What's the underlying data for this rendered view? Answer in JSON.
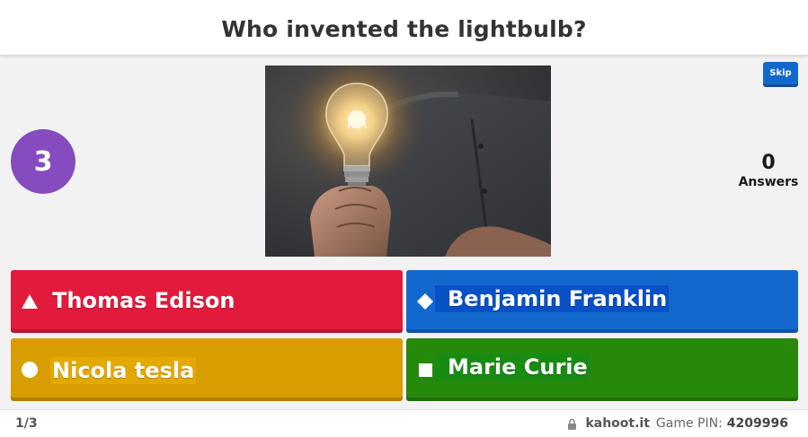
{
  "question": {
    "title": "Who invented the lightbulb?"
  },
  "timer": {
    "value": "3"
  },
  "skip": {
    "label": "Skip"
  },
  "answers_counter": {
    "count": "0",
    "label": "Answers"
  },
  "image": {
    "description_icon": "lightbulb-in-hand-photo"
  },
  "answers": [
    {
      "shape": "triangle",
      "text": "Thomas Edison",
      "color": "#e21b3c"
    },
    {
      "shape": "diamond",
      "text": "Benjamin Franklin",
      "color": "#1368ce"
    },
    {
      "shape": "circle",
      "text": "Nicola tesla",
      "color": "#d89e00"
    },
    {
      "shape": "square",
      "text": "Marie Curie",
      "color": "#26890c"
    }
  ],
  "footer": {
    "progress": "1/3",
    "site": "kahoot.it",
    "pin_label": "Game PIN:",
    "pin_value": "4209996"
  },
  "colors": {
    "timer": "#864cbf",
    "skip": "#1368ce"
  }
}
